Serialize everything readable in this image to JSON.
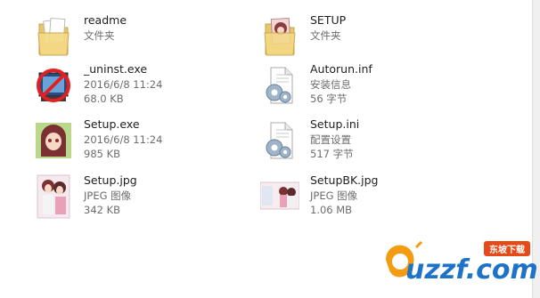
{
  "files": [
    {
      "name": "readme",
      "line2": "文件夹",
      "line3": "",
      "icon": "folder-docs-icon"
    },
    {
      "name": "SETUP",
      "line2": "文件夹",
      "line3": "",
      "icon": "folder-anime-icon"
    },
    {
      "name": "_uninst.exe",
      "line2": "2016/6/8 11:24",
      "line3": "68.0 KB",
      "icon": "uninstall-icon"
    },
    {
      "name": "Autorun.inf",
      "line2": "安装信息",
      "line3": "56 字节",
      "icon": "settings-file-icon"
    },
    {
      "name": "Setup.exe",
      "line2": "2016/6/8 11:24",
      "line3": "985 KB",
      "icon": "anime-app-icon"
    },
    {
      "name": "Setup.ini",
      "line2": "配置设置",
      "line3": "517 字节",
      "icon": "settings-file-icon"
    },
    {
      "name": "Setup.jpg",
      "line2": "JPEG 图像",
      "line3": "342 KB",
      "icon": "image-thumbnail-icon"
    },
    {
      "name": "SetupBK.jpg",
      "line2": "JPEG 图像",
      "line3": "1.06 MB",
      "icon": "image-thumbnail-wide-icon"
    }
  ],
  "watermark": {
    "text": "uzzf.com",
    "badge": "东坡下载"
  }
}
